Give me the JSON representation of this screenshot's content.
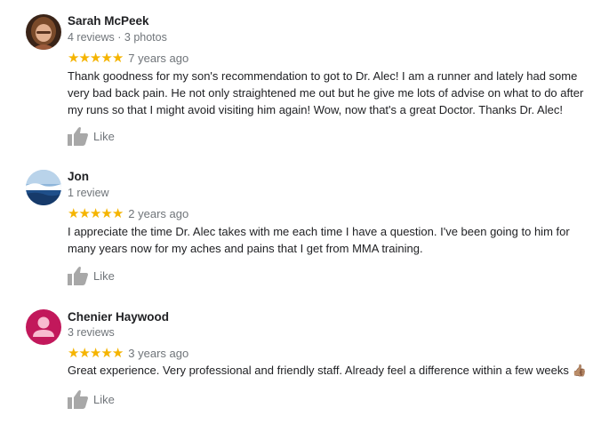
{
  "reviews": [
    {
      "name": "Sarah McPeek",
      "meta": "4 reviews · 3 photos",
      "stars": 5,
      "date": "7 years ago",
      "text": "Thank goodness for my son's recommendation to got to Dr. Alec!  I am a runner and lately had some very bad back pain.  He not only straightened me out but he give me lots of advise on what to do after my runs so that I might avoid visiting him again!  Wow, now that's a great Doctor.  Thanks Dr. Alec!",
      "like_label": "Like",
      "avatar": "photo-avatar-woman"
    },
    {
      "name": "Jon",
      "meta": "1 review",
      "stars": 5,
      "date": "2 years ago",
      "text": "I appreciate the time Dr. Alec takes with me each time I have a question.  I've been going to him for many years now for my aches and pains that I get from MMA training.",
      "like_label": "Like",
      "avatar": "photo-avatar-wave"
    },
    {
      "name": "Chenier Haywood",
      "meta": "3 reviews",
      "stars": 5,
      "date": "3 years ago",
      "text": "Great experience. Very professional and friendly staff. Already feel a difference within a few weeks 👍🏽",
      "like_label": "Like",
      "avatar": "default-person-avatar"
    }
  ],
  "colors": {
    "star": "#f5b400",
    "muted_text": "#70757a",
    "default_avatar": "#c2185b"
  }
}
